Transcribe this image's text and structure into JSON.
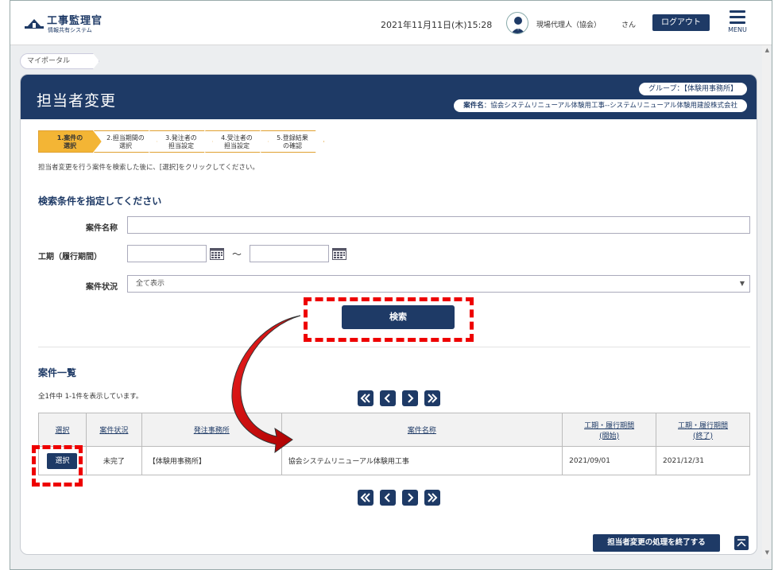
{
  "header": {
    "app_title": "工事監理官",
    "app_subtitle": "情報共有システム",
    "datetime": "2021年11月11日(木)15:28",
    "user_name": "現場代理人（協会）",
    "user_suffix": "さん",
    "logout_label": "ログアウト",
    "menu_label": "MENU"
  },
  "breadcrumb": {
    "label": "マイポータル"
  },
  "page": {
    "title": "担当者変更",
    "group_label": "グループ：【体験用事務所】",
    "case_label_key": "案件名",
    "case_label_value": "：協会システムリニューアル体験用工事--システムリニューアル体験用建設株式会社"
  },
  "steps": [
    {
      "line1": "1.案件の",
      "line2": "選択"
    },
    {
      "line1": "2.担当期間の",
      "line2": "選択"
    },
    {
      "line1": "3.発注者の",
      "line2": "担当設定"
    },
    {
      "line1": "4.受注者の",
      "line2": "担当設定"
    },
    {
      "line1": "5.登録結果",
      "line2": "の確認"
    }
  ],
  "step_hint": "担当者変更を行う案件を検索した後に、[選択]をクリックしてください。",
  "search": {
    "section_title": "検索条件を指定してください",
    "case_name_label": "案件名称",
    "period_label": "工期（履行期間）",
    "period_separator": "～",
    "status_label": "案件状況",
    "status_value": "全て表示",
    "search_button": "検索"
  },
  "list": {
    "section_title": "案件一覧",
    "count_text": "全1件中 1-1件を表示しています。",
    "columns": [
      "選択",
      "案件状況",
      "発注事務所",
      "案件名称",
      "工期・履行期間\n(開始)",
      "工期・履行期間\n(終了)"
    ],
    "rows": [
      {
        "select_label": "選択",
        "status": "未完了",
        "office": "【体験用事務所】",
        "name": "協会システムリニューアル体験用工事",
        "start": "2021/09/01",
        "end": "2021/12/31"
      }
    ]
  },
  "footer": {
    "finish_button": "担当者変更の処理を終了する"
  },
  "colors": {
    "navy": "#1e3a66",
    "step_active": "#f3b535",
    "annotation": "#ee0000"
  },
  "icons": {
    "pager": [
      "first-page-icon",
      "prev-page-icon",
      "next-page-icon",
      "last-page-icon"
    ],
    "calendar": "calendar-icon"
  }
}
